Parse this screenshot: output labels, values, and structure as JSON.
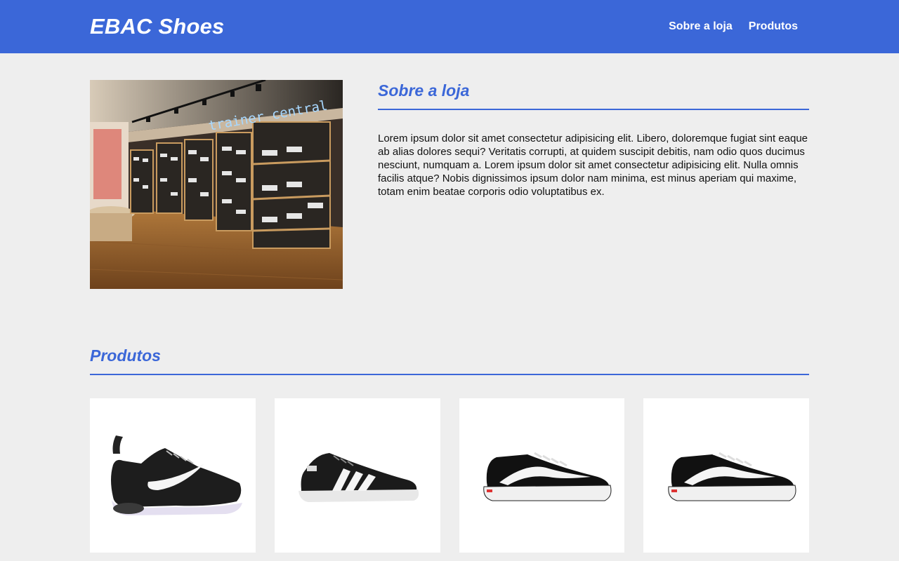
{
  "header": {
    "brand": "EBAC Shoes",
    "nav": [
      {
        "label": "Sobre a loja"
      },
      {
        "label": "Produtos"
      }
    ],
    "color": "#3b67d8"
  },
  "about": {
    "title": "Sobre a loja",
    "text": "Lorem ipsum dolor sit amet consectetur adipisicing elit. Libero, doloremque fugiat sint eaque ab alias dolores sequi? Veritatis corrupti, at quidem suscipit debitis, nam odio quos ducimus nesciunt, numquam a. Lorem ipsum dolor sit amet consectetur adipisicing elit. Nulla omnis facilis atque? Nobis dignissimos ipsum dolor nam minima, est minus aperiam qui maxime, totam enim beatae corporis odio voluptatibus ex.",
    "image_sign": "trainer central"
  },
  "products": {
    "title": "Produtos",
    "items": [
      {
        "kind": "nike-running-shoe"
      },
      {
        "kind": "adidas-court-shoe"
      },
      {
        "kind": "vans-old-skool"
      },
      {
        "kind": "vans-old-skool"
      }
    ]
  }
}
